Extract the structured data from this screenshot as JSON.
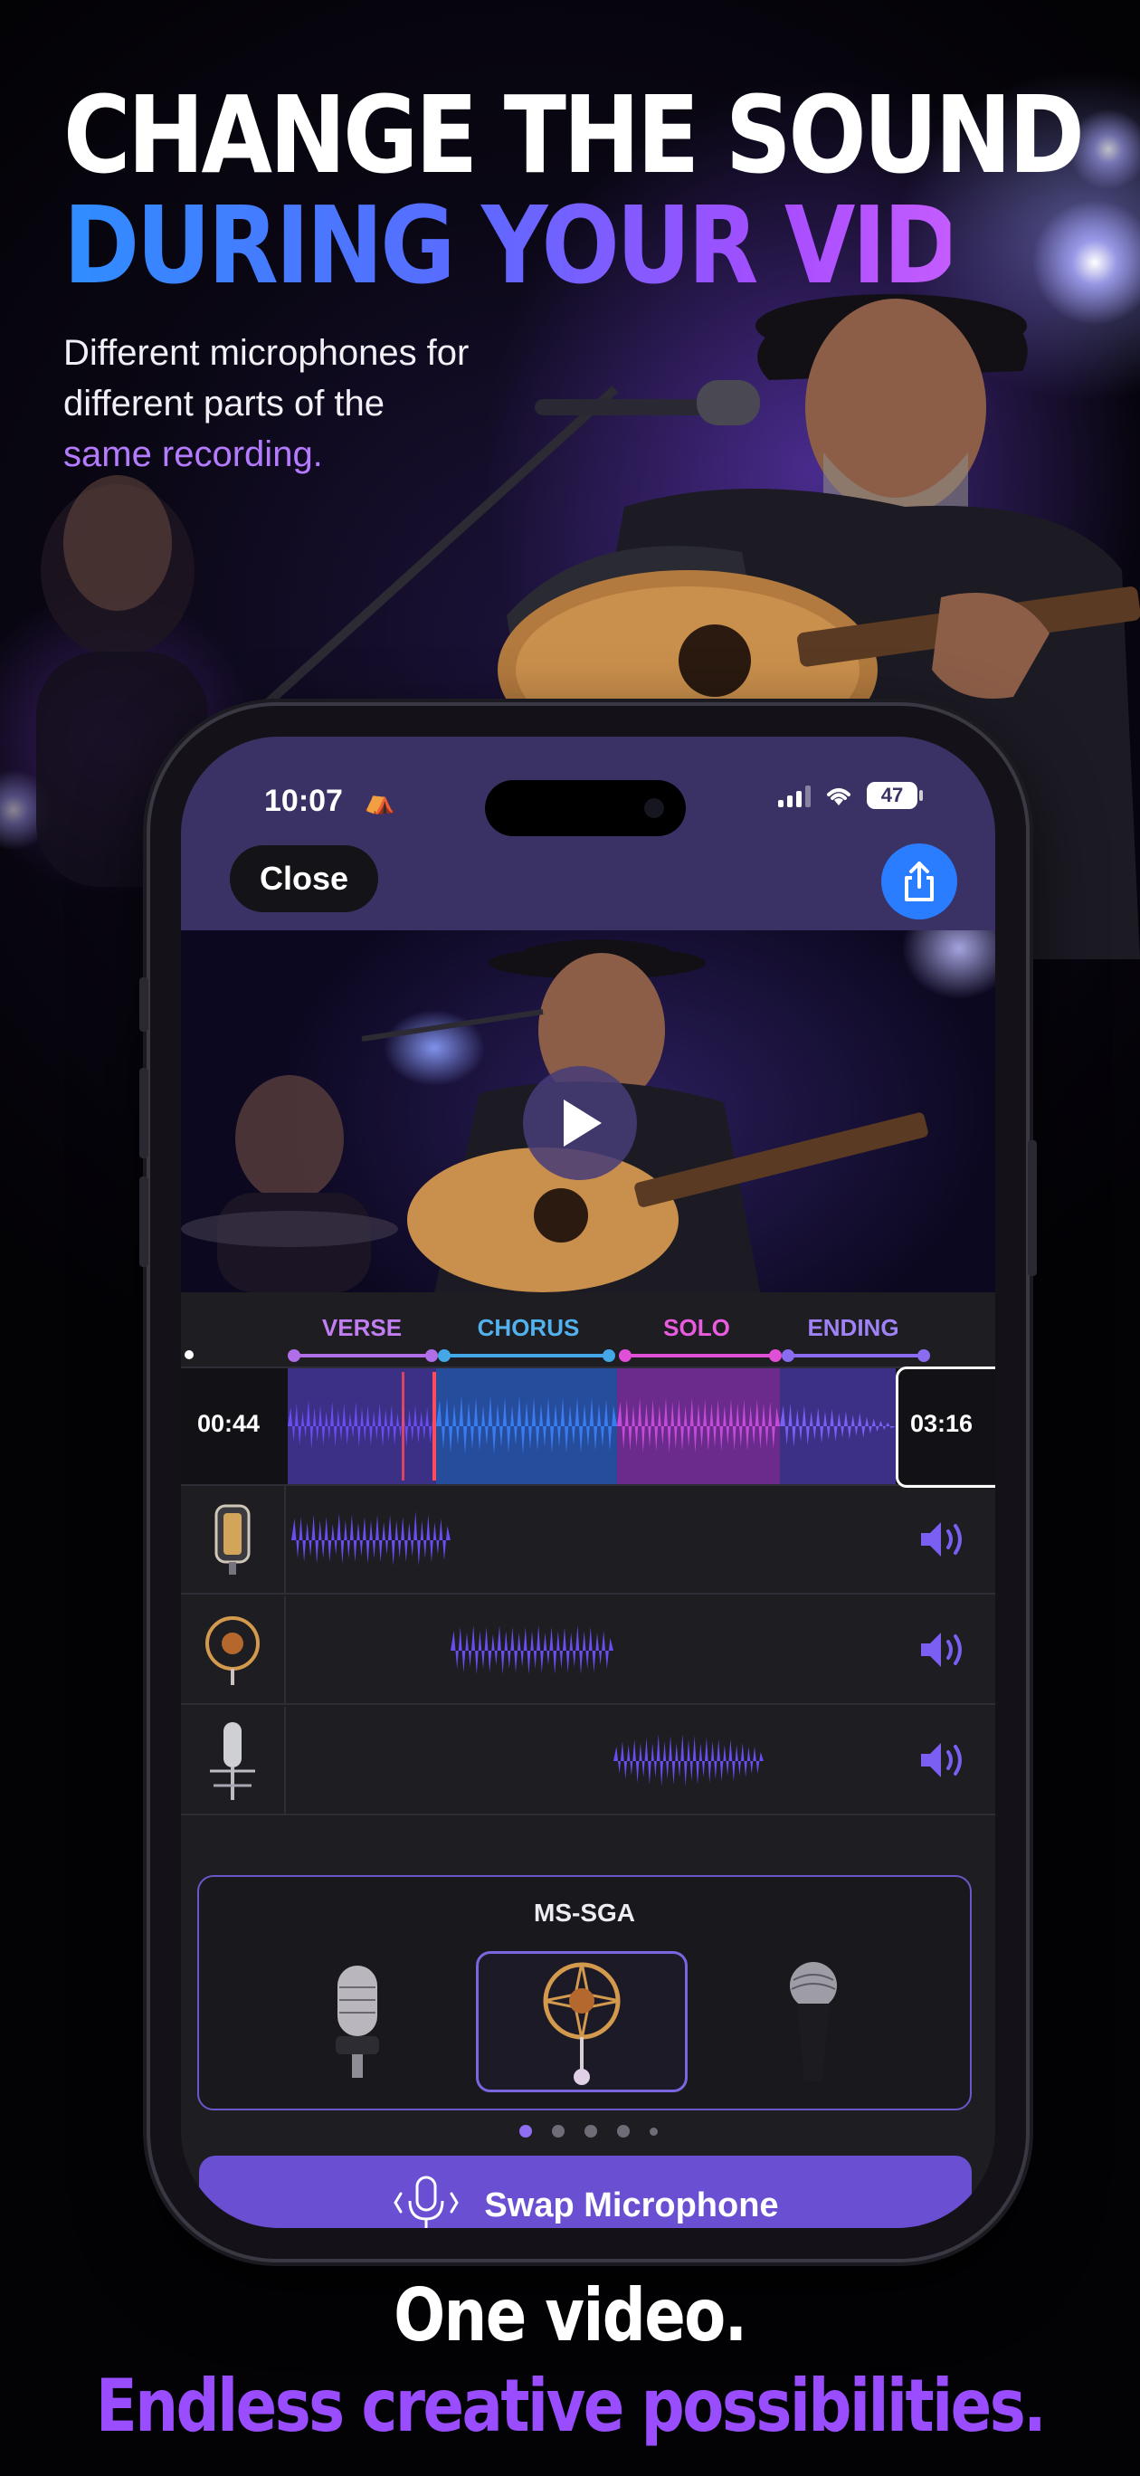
{
  "hero": {
    "title_line1": "CHANGE THE SOUND",
    "title_line2": "DURING YOUR VIDEO",
    "subtitle_line1": "Different microphones for",
    "subtitle_line2": "different parts of the",
    "subtitle_highlight": "same recording."
  },
  "status_bar": {
    "time": "10:07",
    "time_icon": "camping-icon",
    "battery": "47",
    "signal_icon": "cellular-signal-icon",
    "wifi_icon": "wifi-icon"
  },
  "app_bar": {
    "close_label": "Close",
    "share_icon": "share-icon"
  },
  "video": {
    "play_icon": "play-icon"
  },
  "timeline": {
    "sections": [
      {
        "label": "VERSE",
        "color": "#b06ee8"
      },
      {
        "label": "CHORUS",
        "color": "#44a7e8"
      },
      {
        "label": "SOLO",
        "color": "#e04fd8"
      },
      {
        "label": "ENDING",
        "color": "#8a6cf0"
      }
    ],
    "start_time": "00:44",
    "end_time": "03:16",
    "tracks": [
      {
        "mic_icon": "ribbon-microphone-icon",
        "volume_icon": "speaker-icon"
      },
      {
        "mic_icon": "shock-mount-microphone-icon",
        "volume_icon": "speaker-icon"
      },
      {
        "mic_icon": "condenser-microphone-icon",
        "volume_icon": "speaker-icon"
      }
    ]
  },
  "mic_picker": {
    "title": "MS-SGA",
    "options": [
      {
        "icon": "vintage-microphone-icon",
        "selected": false
      },
      {
        "icon": "shock-mount-microphone-icon",
        "selected": true
      },
      {
        "icon": "handheld-microphone-icon",
        "selected": false
      }
    ],
    "pages": 5,
    "active_page": 1
  },
  "swap_button": {
    "label": "Swap Microphone",
    "icon": "microphone-swap-icon"
  },
  "tagline": {
    "line1": "One video.",
    "line2": "Endless creative possibilities."
  },
  "colors": {
    "accent": "#6a4fd3",
    "title_gradient_start": "#2f8dff",
    "title_gradient_end": "#c45cff",
    "highlight_text": "#b57bff",
    "waveform": "#6a4df0"
  }
}
